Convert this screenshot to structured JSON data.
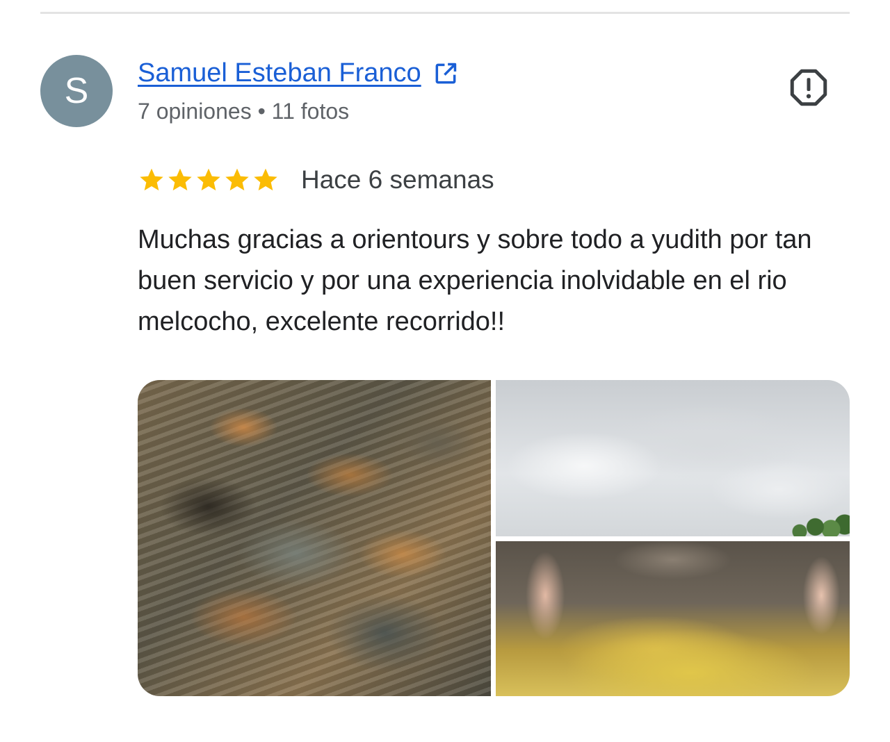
{
  "reviewer": {
    "avatar_letter": "S",
    "avatar_color": "#78909c",
    "name": "Samuel Esteban Franco",
    "name_color": "#1a5fd6",
    "meta": "7 opiniones • 11 fotos",
    "external_link_icon": "open-in-new-icon"
  },
  "report_icon": "report-icon",
  "rating": {
    "stars": 5,
    "max_stars": 5,
    "star_color": "#fbbc04",
    "time_ago": "Hace 6 semanas"
  },
  "review_text": "Muchas gracias a orientours y sobre todo a yudith por tan buen servicio y por una experiencia inolvidable en el rio melcocho, excelente recorrido!!",
  "photos": [
    {
      "subject": "river-rocks-photo"
    },
    {
      "subject": "cloudy-sky-photo"
    },
    {
      "subject": "feet-in-river-photo"
    }
  ]
}
